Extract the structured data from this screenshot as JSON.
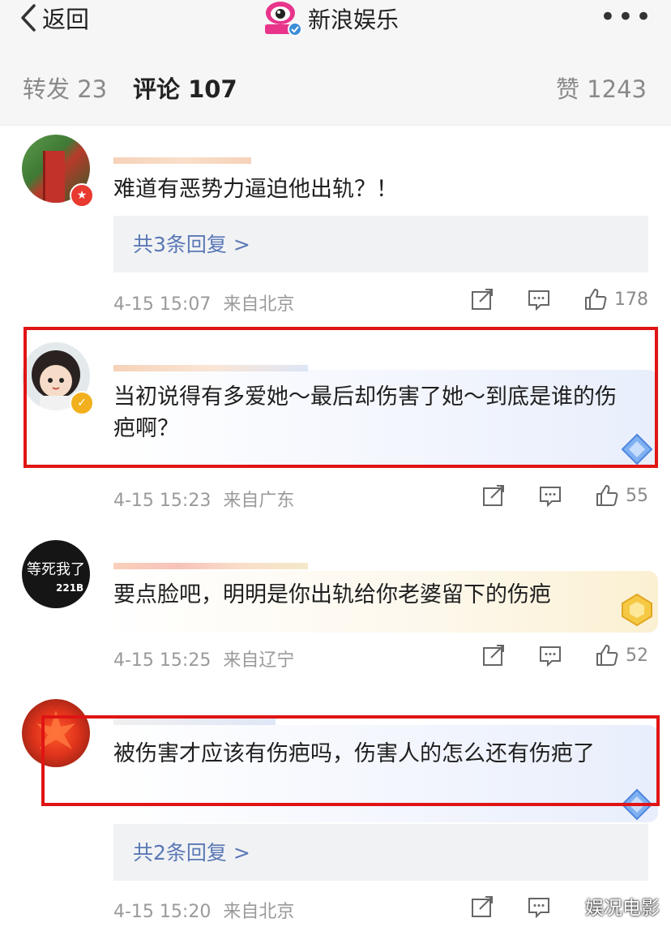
{
  "header": {
    "back_label": "返回",
    "title": "新浪娱乐",
    "logo_text": "新浪娱乐",
    "more_label": "•••"
  },
  "tabs": {
    "forward": "转发 23",
    "comment": "评论 107",
    "like": "赞 1243"
  },
  "comments": [
    {
      "username": "",
      "text": "难道有恶势力逼迫他出轨？！",
      "replies": "共3条回复 >",
      "time": "4-15 15:07",
      "location": "来自北京",
      "likes": "178"
    },
    {
      "username": "",
      "text": "当初说得有多爱她～最后却伤害了她～到底是谁的伤疤啊？",
      "time": "4-15 15:23",
      "location": "来自广东",
      "likes": "55"
    },
    {
      "username": "",
      "avatar_text": "等死我了",
      "avatar_num": "221B",
      "text": "要点脸吧，明明是你出轨给你老婆留下的伤疤",
      "time": "4-15 15:25",
      "location": "来自辽宁",
      "likes": "52"
    },
    {
      "username": "",
      "text": "被伤害才应该有伤疤吗，伤害人的怎么还有伤疤了",
      "replies": "共2条回复 >",
      "time": "4-15 15:20",
      "location": "来自北京",
      "likes": ""
    }
  ],
  "watermark": "娱况电影",
  "colors": {
    "link": "#5a78b6",
    "highlight_frame": "#e01414",
    "username": "#e67a2c"
  }
}
